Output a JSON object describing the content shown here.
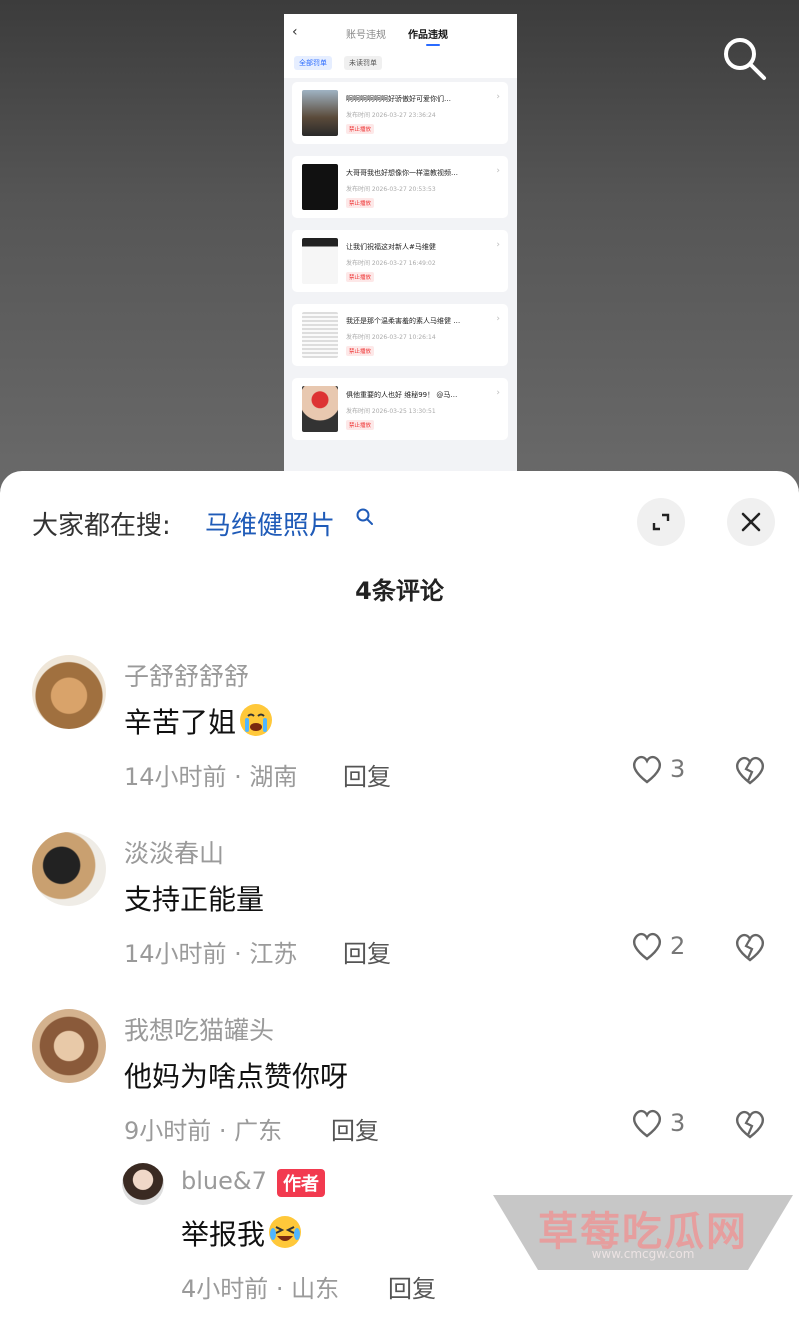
{
  "screenshot": {
    "tabs": [
      "账号违规",
      "作品违规"
    ],
    "filters": [
      "全部罚单",
      "未读罚单"
    ],
    "items": [
      {
        "title": "啊啊啊啊啊啊好骄傲好可爱你们…",
        "time": "发布时间 2026-03-27 23:36:24",
        "badge": "禁止播放"
      },
      {
        "title": "大哥哥我也好想像你一样滥教视频…",
        "time": "发布时间 2026-03-27 20:53:53",
        "badge": "禁止播放"
      },
      {
        "title": "让我们祝福这对新人#马维健",
        "time": "发布时间 2026-03-27 16:49:02",
        "badge": "禁止播放"
      },
      {
        "title": "我还是那个温柔害羞的素人马维健 …",
        "time": "发布时间 2026-03-27 10:26:14",
        "badge": "禁止播放"
      },
      {
        "title": "俱他重要的人也好 维秘99！ @马…",
        "time": "发布时间 2026-03-25 13:30:51",
        "badge": "禁止播放"
      }
    ]
  },
  "sheet": {
    "hot_label": "大家都在搜:",
    "hot_query": "马维健照片",
    "comment_count": "4条评论"
  },
  "comments": [
    {
      "name": "子舒舒舒舒",
      "text": "辛苦了姐",
      "meta": "14小时前 · 湖南",
      "reply": "回复",
      "likes": "3"
    },
    {
      "name": "淡淡春山",
      "text": "支持正能量",
      "meta": "14小时前 · 江苏",
      "reply": "回复",
      "likes": "2"
    },
    {
      "name": "我想吃猫罐头",
      "text": "他妈为啥点赞你呀",
      "meta": "9小时前 · 广东",
      "reply": "回复",
      "likes": "3"
    }
  ],
  "reply": {
    "name": "blue&7",
    "badge": "作者",
    "text": "举报我",
    "meta": "4小时前 · 山东",
    "reply": "回复"
  },
  "watermark": {
    "text": "草莓吃瓜网",
    "url": "www.cmcgw.com"
  }
}
